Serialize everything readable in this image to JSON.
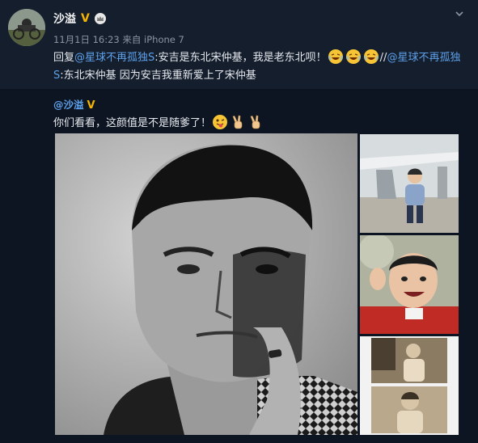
{
  "post": {
    "author": "沙溢",
    "verified_mark": "V",
    "crown_icon": "crown-icon",
    "meta": "11月1日 16:23 来自 iPhone 7",
    "reply_prefix": "回复",
    "mention1": "@星球不再孤独S",
    "text1": ":安吉是东北宋仲基，我是老东北呗！",
    "separator": "//",
    "mention2": "@星球不再孤独S",
    "text2": ":东北宋仲基 因为安吉我重新爱上了宋仲基"
  },
  "repost": {
    "author": "@沙溢",
    "verified_mark": "V",
    "text": "你们看看，这颜值是不是随爹了！"
  },
  "colors": {
    "background": "#121c2a",
    "link": "#5ea1ea",
    "verified": "#f5b400"
  }
}
